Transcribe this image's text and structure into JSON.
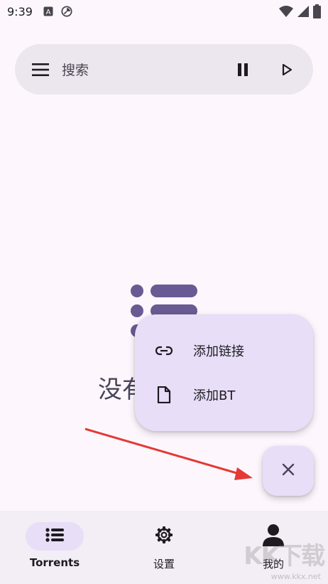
{
  "status_bar": {
    "time": "9:39",
    "left_icons": [
      "a-badge-icon",
      "sync-icon"
    ],
    "right_icons": [
      "wifi-icon",
      "signal-icon",
      "battery-icon"
    ]
  },
  "search": {
    "placeholder": "搜索",
    "menu_icon": "menu-icon",
    "pause_icon": "pause-icon",
    "play_icon": "play-icon"
  },
  "empty_state": {
    "text": "没有",
    "icon": "list-icon",
    "icon_color": "#6a5a93"
  },
  "fab_menu": {
    "items": [
      {
        "label": "添加链接",
        "icon": "link-icon"
      },
      {
        "label": "添加BT",
        "icon": "file-icon"
      }
    ]
  },
  "fab": {
    "icon": "close-icon"
  },
  "bottom_nav": {
    "items": [
      {
        "label": "Torrents",
        "icon": "list-icon",
        "active": true
      },
      {
        "label": "设置",
        "icon": "gear-icon",
        "active": false
      },
      {
        "label": "我的",
        "icon": "person-icon",
        "active": false
      }
    ]
  },
  "watermark": {
    "text": "KK下载",
    "url": "www.kkx.net"
  },
  "colors": {
    "background": "#fdf7fd",
    "surface": "#ece6ef",
    "menu_surface": "#e8def8",
    "accent": "#6a5a93",
    "arrow": "#e53935"
  }
}
